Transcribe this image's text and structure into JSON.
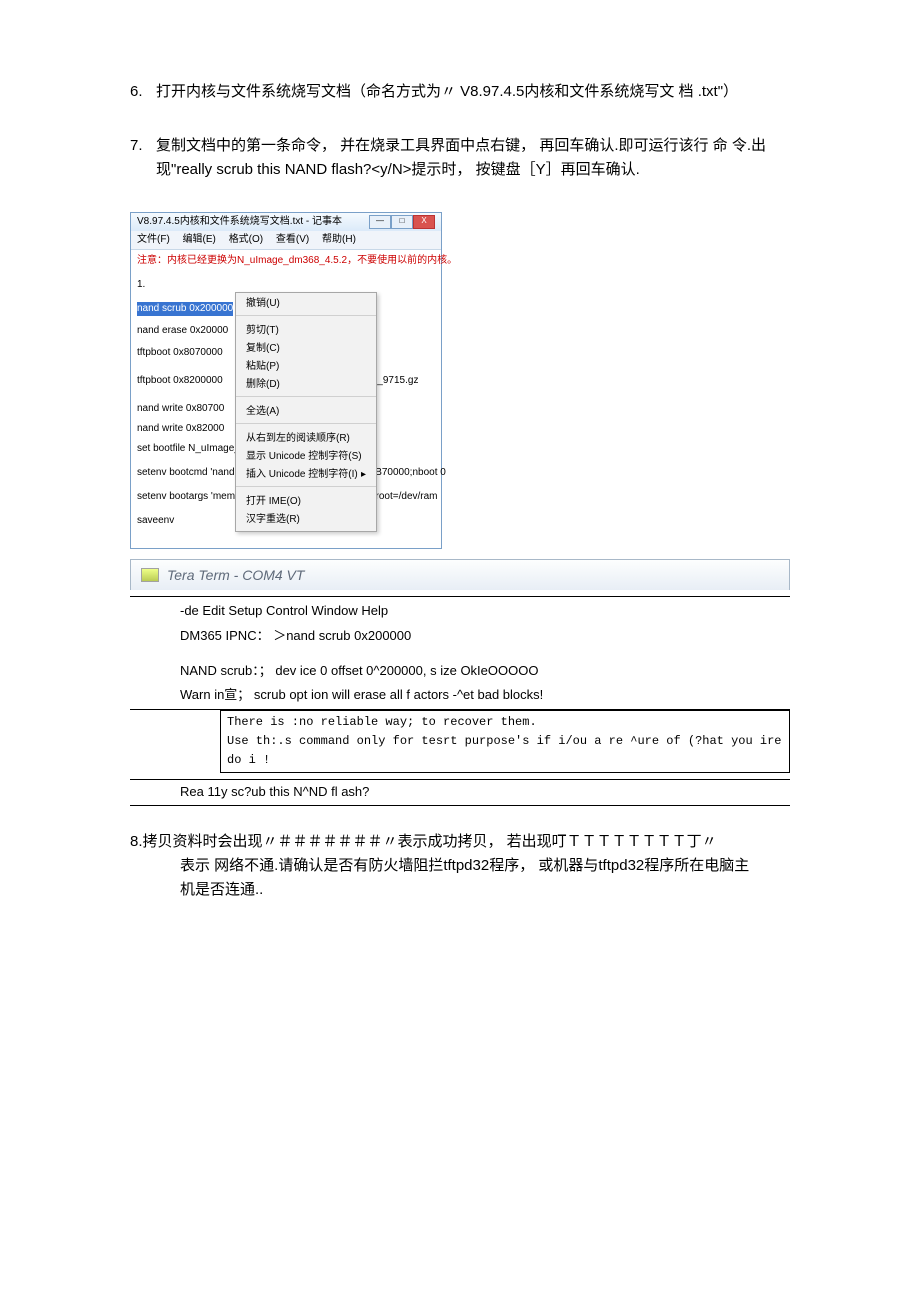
{
  "item6": {
    "num": "6.",
    "text": "打开内核与文件系统烧写文档（命名方式为〃 V8.97.4.5内核和文件系统烧写文 档 .txt\"）"
  },
  "item7": {
    "num": "7.",
    "text": "复制文档中的第一条命令， 并在烧录工具界面中点右键， 再回车确认.即可运行该行 命 令.出现\"really scrub this NAND flash?<y/N>提示时， 按键盘［Y］再回车确认."
  },
  "notepad": {
    "title": "V8.97.4.5内核和文件系统烧写文档.txt - 记事本",
    "menu": {
      "file": "文件(F)",
      "edit": "编辑(E)",
      "format": "格式(O)",
      "view": "查看(V)",
      "help": "帮助(H)"
    },
    "note": "注意：内核已经更换为N_uImage_dm368_4.5.2，不要使用以前的内核。",
    "line1": "1.",
    "sel": "nand scrub 0x200000",
    "lines": {
      "l2": "nand erase 0x20000",
      "l3": "tftpboot 0x8070000",
      "l4a": "tftpboot 0x8200000",
      "l4b": "121112_9715.gz",
      "l5": "nand write 0x80700",
      "l6": "nand write 0x82000",
      "l7": "set bootfile N_uImage_dm368_4.5.2",
      "l8": "setenv bootcmd 'nand read 0x82000000 0x400000 0xB70000;nboot 0",
      "l9": "setenv bootargs 'mem=60M console=ttyS1,115200n8 root=/dev/ram",
      "l10": "saveenv"
    }
  },
  "ctx": {
    "undo": "撤销(U)",
    "cut": "剪切(T)",
    "copy": "复制(C)",
    "paste": "粘贴(P)",
    "del": "删除(D)",
    "all": "全选(A)",
    "rtl": "从右到左的阅读顺序(R)",
    "showu": "显示 Unicode 控制字符(S)",
    "insu": "插入 Unicode 控制字符(I)",
    "ime": "打开 IME(O)",
    "reconv": "汉字重选(R)"
  },
  "tt": {
    "title": "Tera Term - COM4 VT",
    "menu": "-de Edit Setup Control Window Help",
    "l1": "DM365 IPNC： ＞nand scrub 0x200000",
    "l2": "NAND scrub：； dev ice 0 offset 0^200000, s ize OkIeOOOOO",
    "l3": "Warn in宣； scrub opt ion will erase all f actors -^et bad blocks!",
    "box1": "There is :no reliable way; to recover them.",
    "box2": "Use th:.s command only for tesrt purpose's if i/ou a re ^ure of (?hat you ire do i !",
    "l4": "Rea 11y sc?ub this N^ND fl ash?"
  },
  "item8": {
    "num": "8.",
    "l1": "拷贝资料时会出现〃＃＃＃＃＃＃＃〃表示成功拷贝， 若出现叮ＴＴＴＴＴＴＴＴ丁〃",
    "l2": "表示 网络不通.请确认是否有防火墙阻拦tftpd32程序， 或机器与tftpd32程序所在电脑主",
    "l3": "机是否连通.."
  }
}
